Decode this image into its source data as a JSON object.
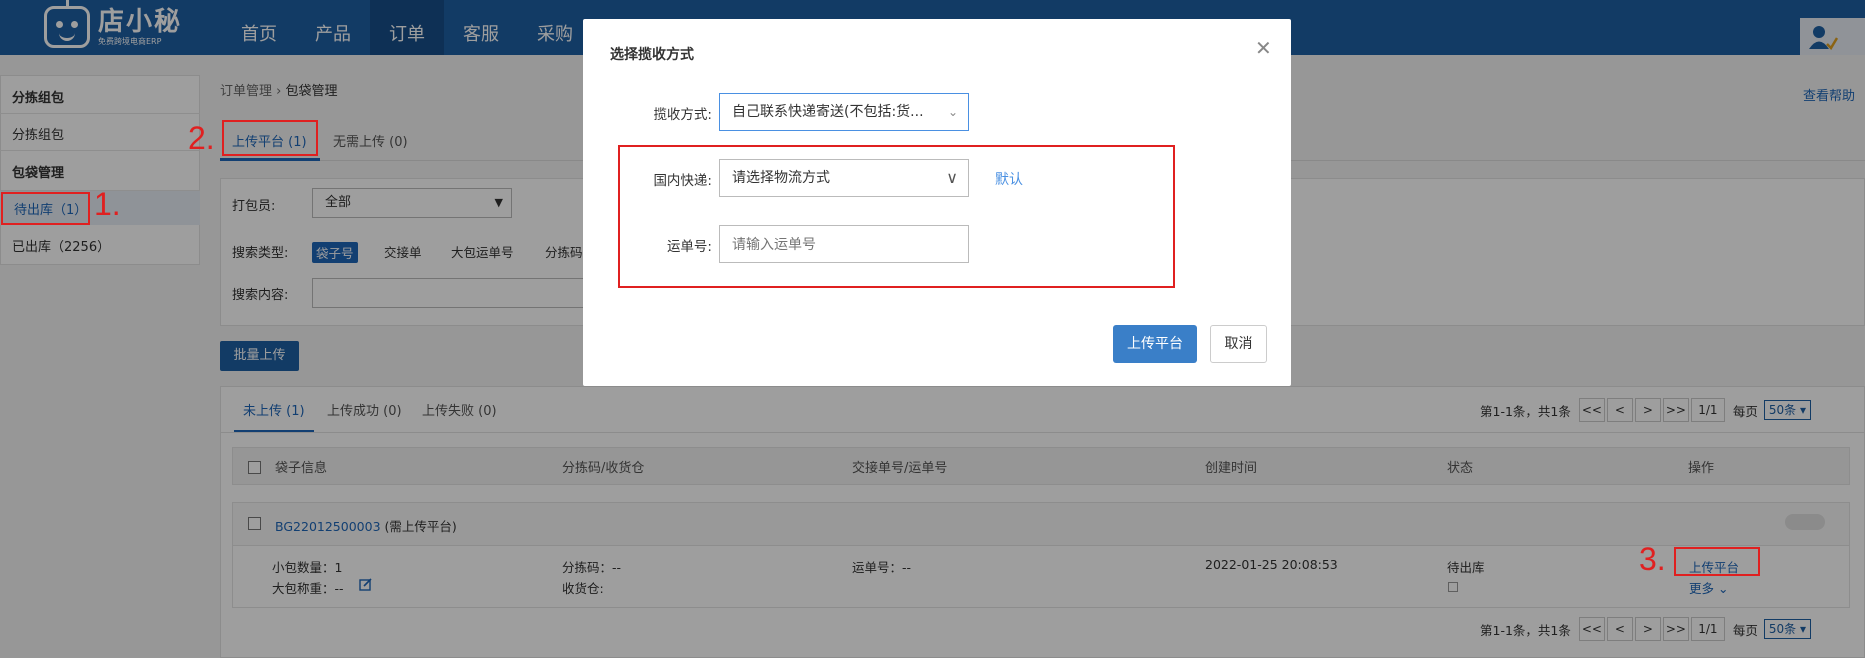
{
  "app": {
    "logo_name": "店小秘",
    "logo_subtitle": "免费跨境电商ERP"
  },
  "nav": {
    "items": [
      {
        "label": "首页"
      },
      {
        "label": "产品"
      },
      {
        "label": "订单"
      },
      {
        "label": "客服"
      },
      {
        "label": "采购"
      }
    ],
    "active": "订单"
  },
  "sidebar": {
    "section1": "分拣组包",
    "item1": "分拣组包",
    "section2": "包袋管理",
    "item_active": "待出库（1）",
    "item2": "已出库（2256）"
  },
  "breadcrumb": {
    "parent": "订单管理",
    "separator": "›",
    "current": "包袋管理"
  },
  "help": "查看帮助",
  "tabs": {
    "upload": "上传平台 (1)",
    "no_upload": "无需上传 (0)"
  },
  "filters": {
    "packer_label": "打包员:",
    "packer_value": "全部",
    "search_type_label": "搜索类型:",
    "search_types": [
      "袋子号",
      "交接单",
      "大包运单号",
      "分拣码"
    ],
    "search_content_label": "搜索内容:"
  },
  "batch_upload": "批量上传",
  "sub_tabs": [
    "未上传 (1)",
    "上传成功 (0)",
    "上传失败 (0)"
  ],
  "pagination": {
    "info": "第1-1条，共1条",
    "first": "<<",
    "prev": "<",
    "next": ">",
    "last": ">>",
    "page": "1/1",
    "per_page_label": "每页",
    "per_page_value": "50条"
  },
  "table": {
    "headers": [
      "袋子信息",
      "分拣码/收货仓",
      "交接单号/运单号",
      "创建时间",
      "状态",
      "操作"
    ],
    "row": {
      "bag_id": "BG22012500003",
      "bag_note": "(需上传平台)",
      "small_qty_label": "小包数量：",
      "small_qty": "1",
      "weight_label": "大包称重：",
      "weight": "--",
      "sort_code_label": "分拣码：",
      "sort_code": "--",
      "warehouse_label": "收货仓:",
      "tracking_label": "运单号：",
      "tracking": "--",
      "created": "2022-01-25 20:08:53",
      "status": "待出库",
      "action": "上传平台",
      "more": "更多"
    }
  },
  "modal": {
    "title": "选择揽收方式",
    "pickup_label": "揽收方式:",
    "pickup_value": "自己联系快递寄送(不包括:货...",
    "domestic_label": "国内快递:",
    "domestic_placeholder": "请选择物流方式",
    "default_link": "默认",
    "tracking_label": "运单号:",
    "tracking_placeholder": "请输入运单号",
    "confirm": "上传平台",
    "cancel": "取消"
  },
  "annotations": {
    "n1": "1.",
    "n2": "2.",
    "n3": "3."
  },
  "colors": {
    "nav_bg": "#1e5fa3",
    "accent": "#1e66b8",
    "annotation_red": "#e02020"
  }
}
